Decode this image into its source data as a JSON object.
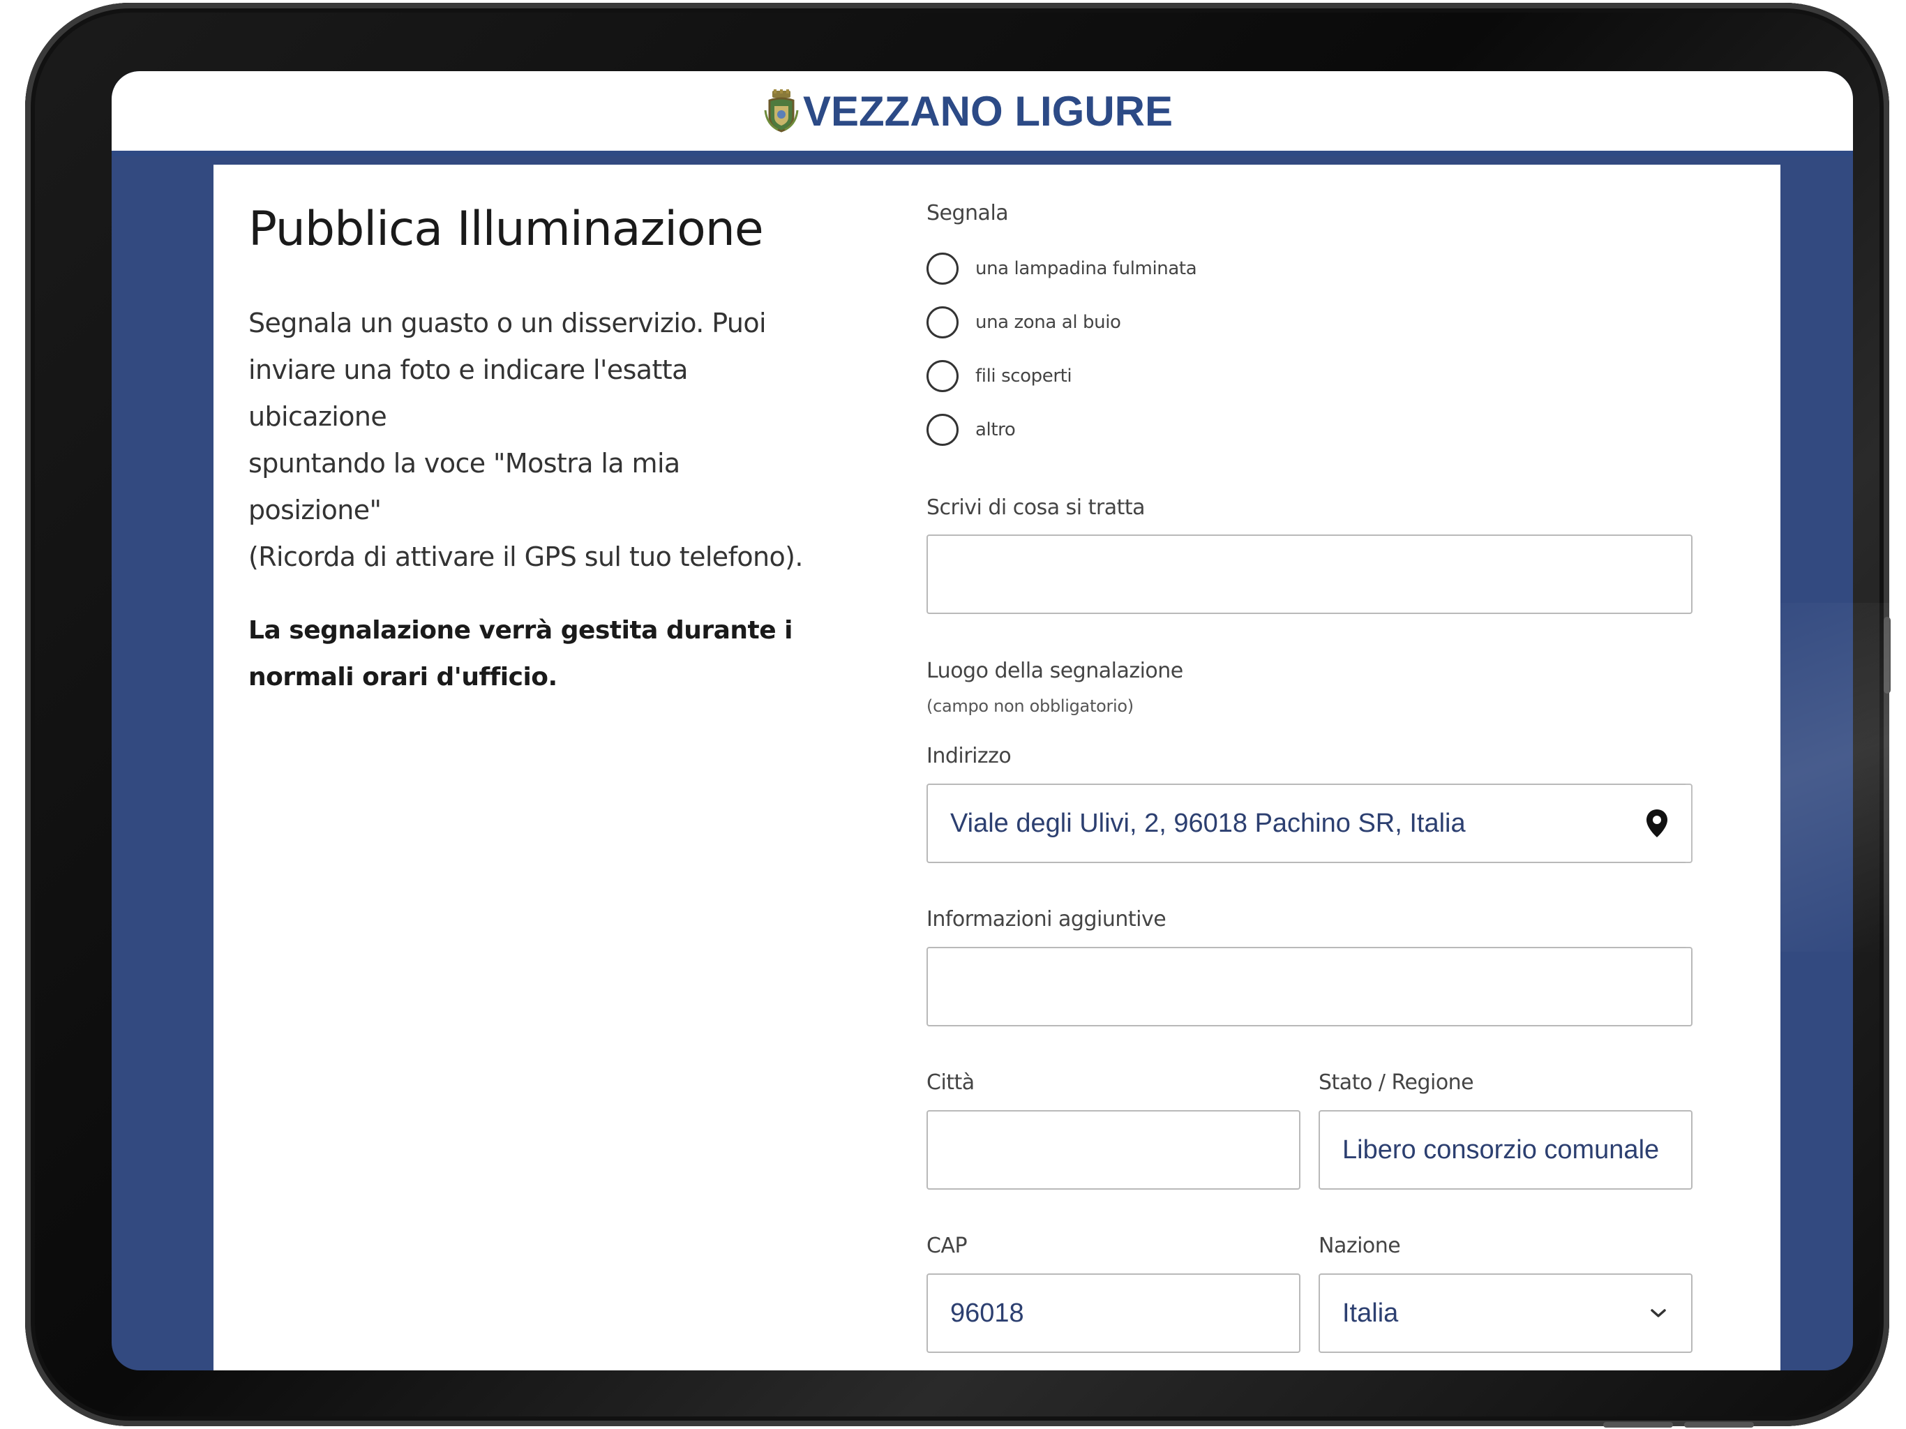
{
  "header": {
    "site_title": "VEZZANO LIGURE"
  },
  "intro": {
    "title": "Pubblica Illuminazione",
    "description_lines": [
      "Segnala un guasto o un disservizio. Puoi",
      "inviare una foto e indicare l'esatta ubicazione",
      "spuntando la voce \"Mostra la mia posizione\"",
      "(Ricorda di attivare il GPS sul tuo telefono)."
    ],
    "notice_lines": [
      "La segnalazione verrà gestita durante i",
      "normali orari d'ufficio."
    ]
  },
  "form": {
    "segnala_label": "Segnala",
    "options": [
      {
        "label": "una lampadina fulminata",
        "selected": false
      },
      {
        "label": "una zona al buio",
        "selected": false
      },
      {
        "label": "fili scoperti",
        "selected": false
      },
      {
        "label": "altro",
        "selected": false
      }
    ],
    "description_label": "Scrivi di cosa si tratta",
    "description_value": "",
    "location_label": "Luogo della segnalazione",
    "location_note": "(campo non obbligatorio)",
    "address_label": "Indirizzo",
    "address_value": "Viale degli Ulivi, 2, 96018 Pachino SR, Italia",
    "extra_info_label": "Informazioni aggiuntive",
    "extra_info_value": "",
    "city_label": "Città",
    "city_value": "",
    "state_label": "Stato / Regione",
    "state_value": "Libero consorzio comunale",
    "cap_label": "CAP",
    "cap_value": "96018",
    "country_label": "Nazione",
    "country_value": "Italia"
  },
  "colors": {
    "brand_blue": "#2c4a86",
    "background_blue": "#334a80",
    "input_text": "#2c3f70"
  },
  "icons": {
    "header": "crest-icon",
    "address": "location-pin-icon",
    "country": "chevron-down-icon"
  }
}
